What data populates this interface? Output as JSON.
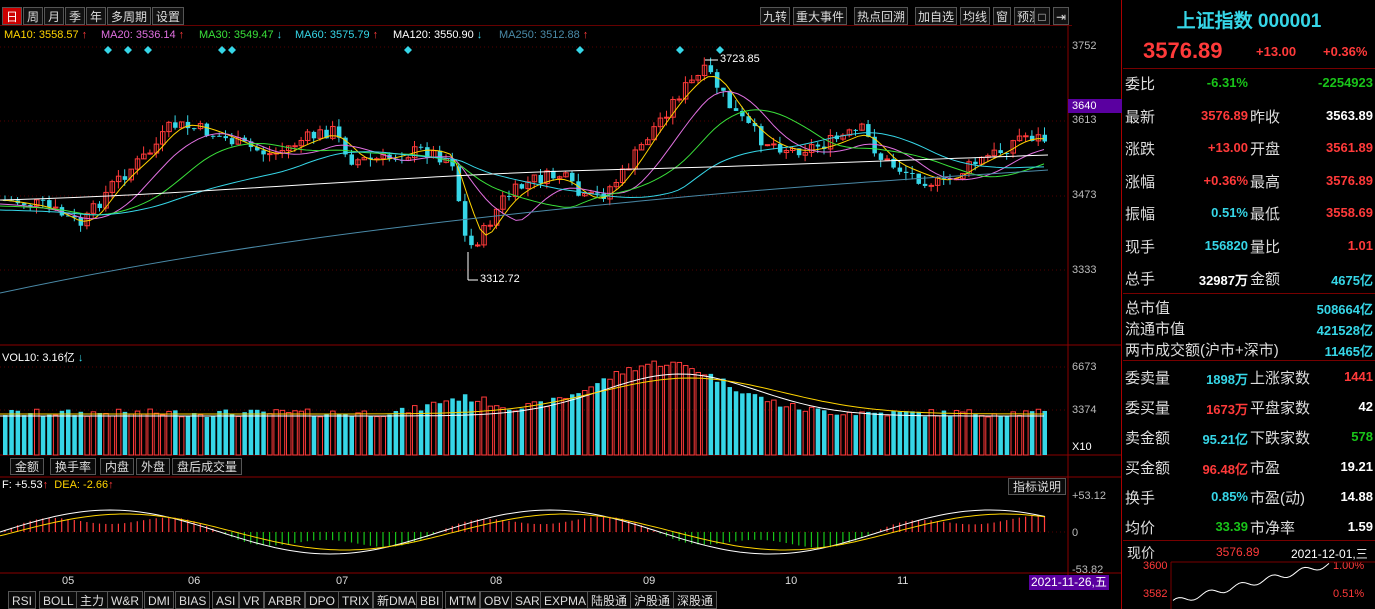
{
  "toolbar": {
    "periods": [
      "日",
      "周",
      "月",
      "季",
      "年",
      "多周期",
      "设置"
    ],
    "active_period": "日",
    "tools": [
      "九转",
      "重大事件",
      "热点回溯",
      "加自选",
      "均线",
      "窗",
      "预测"
    ],
    "icons": [
      "layout-icon",
      "expand-icon"
    ]
  },
  "ma_legend": [
    {
      "label": "MA10: 3558.57",
      "arrow": "↑",
      "color": "#ffd400"
    },
    {
      "label": "MA20: 3536.14",
      "arrow": "↑",
      "color": "#e070e0"
    },
    {
      "label": "MA30: 3549.47",
      "arrow": "↓",
      "color": "#3ae03a"
    },
    {
      "label": "MA60: 3575.79",
      "arrow": "↑",
      "color": "#36d6e7"
    },
    {
      "label": "MA120: 3550.90",
      "arrow": "↓",
      "color": "#ffffff"
    },
    {
      "label": "MA250: 3512.88",
      "arrow": "↑",
      "color": "#4a8aa8"
    }
  ],
  "price_axis": {
    "ticks": [
      "3752",
      "3613",
      "3473",
      "3333"
    ],
    "current": "3640"
  },
  "annotations": {
    "high": "3723.85",
    "low": "3312.72"
  },
  "volume": {
    "legend": "VOL10: 3.16亿",
    "arrow": "↓",
    "ticks": [
      "6673",
      "3374"
    ],
    "unit": "X10"
  },
  "sub_tabs": [
    "金额",
    "换手率",
    "内盘",
    "外盘",
    "盘后成交量"
  ],
  "macd": {
    "legend_dif": "F: +5.53",
    "legend_dea": "DEA: -2.66",
    "ticks": [
      "+53.12",
      "0",
      "-53.82"
    ],
    "explain_btn": "指标说明"
  },
  "months": [
    "05",
    "06",
    "07",
    "08",
    "09",
    "10",
    "11"
  ],
  "date_label": "2021-11-26,五",
  "bottom_tabs": [
    "RSI",
    "BOLL",
    "主力",
    "W&R",
    "DMI",
    "BIAS",
    "ASI",
    "VR",
    "ARBR",
    "DPO",
    "TRIX",
    "新DMA",
    "BBI",
    "MTM",
    "OBV",
    "SAR",
    "EXPMA",
    "陆股通",
    "沪股通",
    "深股通"
  ],
  "panel": {
    "title": "上证指数 000001",
    "price": "3576.89",
    "change": "+13.00",
    "change_pct": "+0.36%",
    "rows": [
      {
        "l1": "委比",
        "v1": "-6.31%",
        "c1": "#19c419",
        "l2": "",
        "v2": "-2254923",
        "c2": "#19c419"
      },
      {
        "l1": "最新",
        "v1": "3576.89",
        "c1": "#ff3a3a",
        "l2": "昨收",
        "v2": "3563.89",
        "c2": "#ffffff"
      },
      {
        "l1": "涨跌",
        "v1": "+13.00",
        "c1": "#ff3a3a",
        "l2": "开盘",
        "v2": "3561.89",
        "c2": "#ff3a3a"
      },
      {
        "l1": "涨幅",
        "v1": "+0.36%",
        "c1": "#ff3a3a",
        "l2": "最高",
        "v2": "3576.89",
        "c2": "#ff3a3a"
      },
      {
        "l1": "振幅",
        "v1": "0.51%",
        "c1": "#36d6e7",
        "l2": "最低",
        "v2": "3558.69",
        "c2": "#ff3a3a"
      },
      {
        "l1": "现手",
        "v1": "156820",
        "c1": "#36d6e7",
        "l2": "量比",
        "v2": "1.01",
        "c2": "#ff3a3a"
      },
      {
        "l1": "总手",
        "v1": "32987万",
        "c1": "#ffffff",
        "l2": "金额",
        "v2": "4675亿",
        "c2": "#36d6e7"
      }
    ],
    "rows2": [
      {
        "l": "总市值",
        "v": "508664亿"
      },
      {
        "l": "流通市值",
        "v": "421528亿"
      },
      {
        "l": "两市成交额(沪市+深市)",
        "v": "11465亿"
      }
    ],
    "rows3": [
      {
        "l1": "委卖量",
        "v1": "1898万",
        "c1": "#36d6e7",
        "l2": "上涨家数",
        "v2": "1441",
        "c2": "#ff3a3a"
      },
      {
        "l1": "委买量",
        "v1": "1673万",
        "c1": "#ff3a3a",
        "l2": "平盘家数",
        "v2": "42",
        "c2": "#ffffff"
      },
      {
        "l1": "卖金额",
        "v1": "95.21亿",
        "c1": "#36d6e7",
        "l2": "下跌家数",
        "v2": "578",
        "c2": "#19c419"
      },
      {
        "l1": "买金额",
        "v1": "96.48亿",
        "c1": "#ff3a3a",
        "l2": "市盈",
        "v2": "19.21",
        "c2": "#ffffff"
      },
      {
        "l1": "换手",
        "v1": "0.85%",
        "c1": "#36d6e7",
        "l2": "市盈(动)",
        "v2": "14.88",
        "c2": "#ffffff"
      },
      {
        "l1": "均价",
        "v1": "33.39",
        "c1": "#19c419",
        "l2": "市净率",
        "v2": "1.59",
        "c2": "#ffffff"
      }
    ],
    "mini": {
      "label": "现价",
      "price": "3576.89",
      "date": "2021-12-01,三",
      "y_hi": "3600",
      "y_lo": "3582",
      "p_hi": "1.00%",
      "p_lo": "0.51%"
    }
  },
  "colors": {
    "up": "#ff3a3a",
    "down": "#36d6e7",
    "grid": "#7a0000"
  }
}
